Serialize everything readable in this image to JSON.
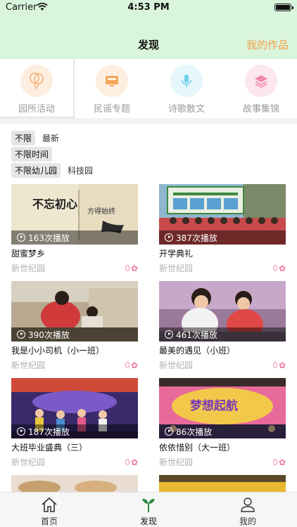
{
  "status_bar": {
    "carrier": "Carrier",
    "time": "4:53 PM"
  },
  "header": {
    "title": "发现",
    "my_works": "我的作品"
  },
  "categories": [
    {
      "label": "园所活动",
      "icon": "balloon-icon",
      "bg": "#fdeee0",
      "color": "#f4b27a"
    },
    {
      "label": "民谣专题",
      "icon": "guitar-box-icon",
      "bg": "#fdeee0",
      "color": "#f4a65a"
    },
    {
      "label": "诗歌散文",
      "icon": "microphone-icon",
      "bg": "#e5f7fb",
      "color": "#6fd0ea"
    },
    {
      "label": "故事集锦",
      "icon": "layers-icon",
      "bg": "#fde7ee",
      "color": "#f08aa8"
    }
  ],
  "filters": {
    "row1": {
      "selected": "不限",
      "option": "最新"
    },
    "row2": {
      "selected": "不限时间"
    },
    "row3": {
      "selected": "不限幼儿园",
      "option": "科技园"
    }
  },
  "videos": [
    {
      "title": "甜蜜梦乡",
      "plays": "163次播放",
      "school": "新世纪园",
      "likes": "0"
    },
    {
      "title": "开学典礼",
      "plays": "387次播放",
      "school": "新世纪园",
      "likes": "0"
    },
    {
      "title": "我是小小司机（小一班）",
      "plays": "390次播放",
      "school": "新世纪园",
      "likes": "0"
    },
    {
      "title": "最美的遇见（小班）",
      "plays": "461次播放",
      "school": "新世纪园",
      "likes": "0"
    },
    {
      "title": "大班毕业盛典（三）",
      "plays": "187次播放",
      "school": "新世纪园",
      "likes": "0"
    },
    {
      "title": "依依惜别（大一班）",
      "plays": "86次播放",
      "school": "新世纪园",
      "likes": "0"
    }
  ],
  "thumb_text": {
    "calligraphy_1": "不忘初心",
    "calligraphy_2": "方得始终",
    "banner": "梦想起航"
  },
  "tab_bar": [
    {
      "label": "首页",
      "icon": "home-icon"
    },
    {
      "label": "发现",
      "icon": "sprout-icon"
    },
    {
      "label": "我的",
      "icon": "user-icon"
    }
  ],
  "colors": {
    "header_bg": "#d9f5dc",
    "accent_orange": "#f2a14a",
    "like_pink": "#f07a9a"
  }
}
